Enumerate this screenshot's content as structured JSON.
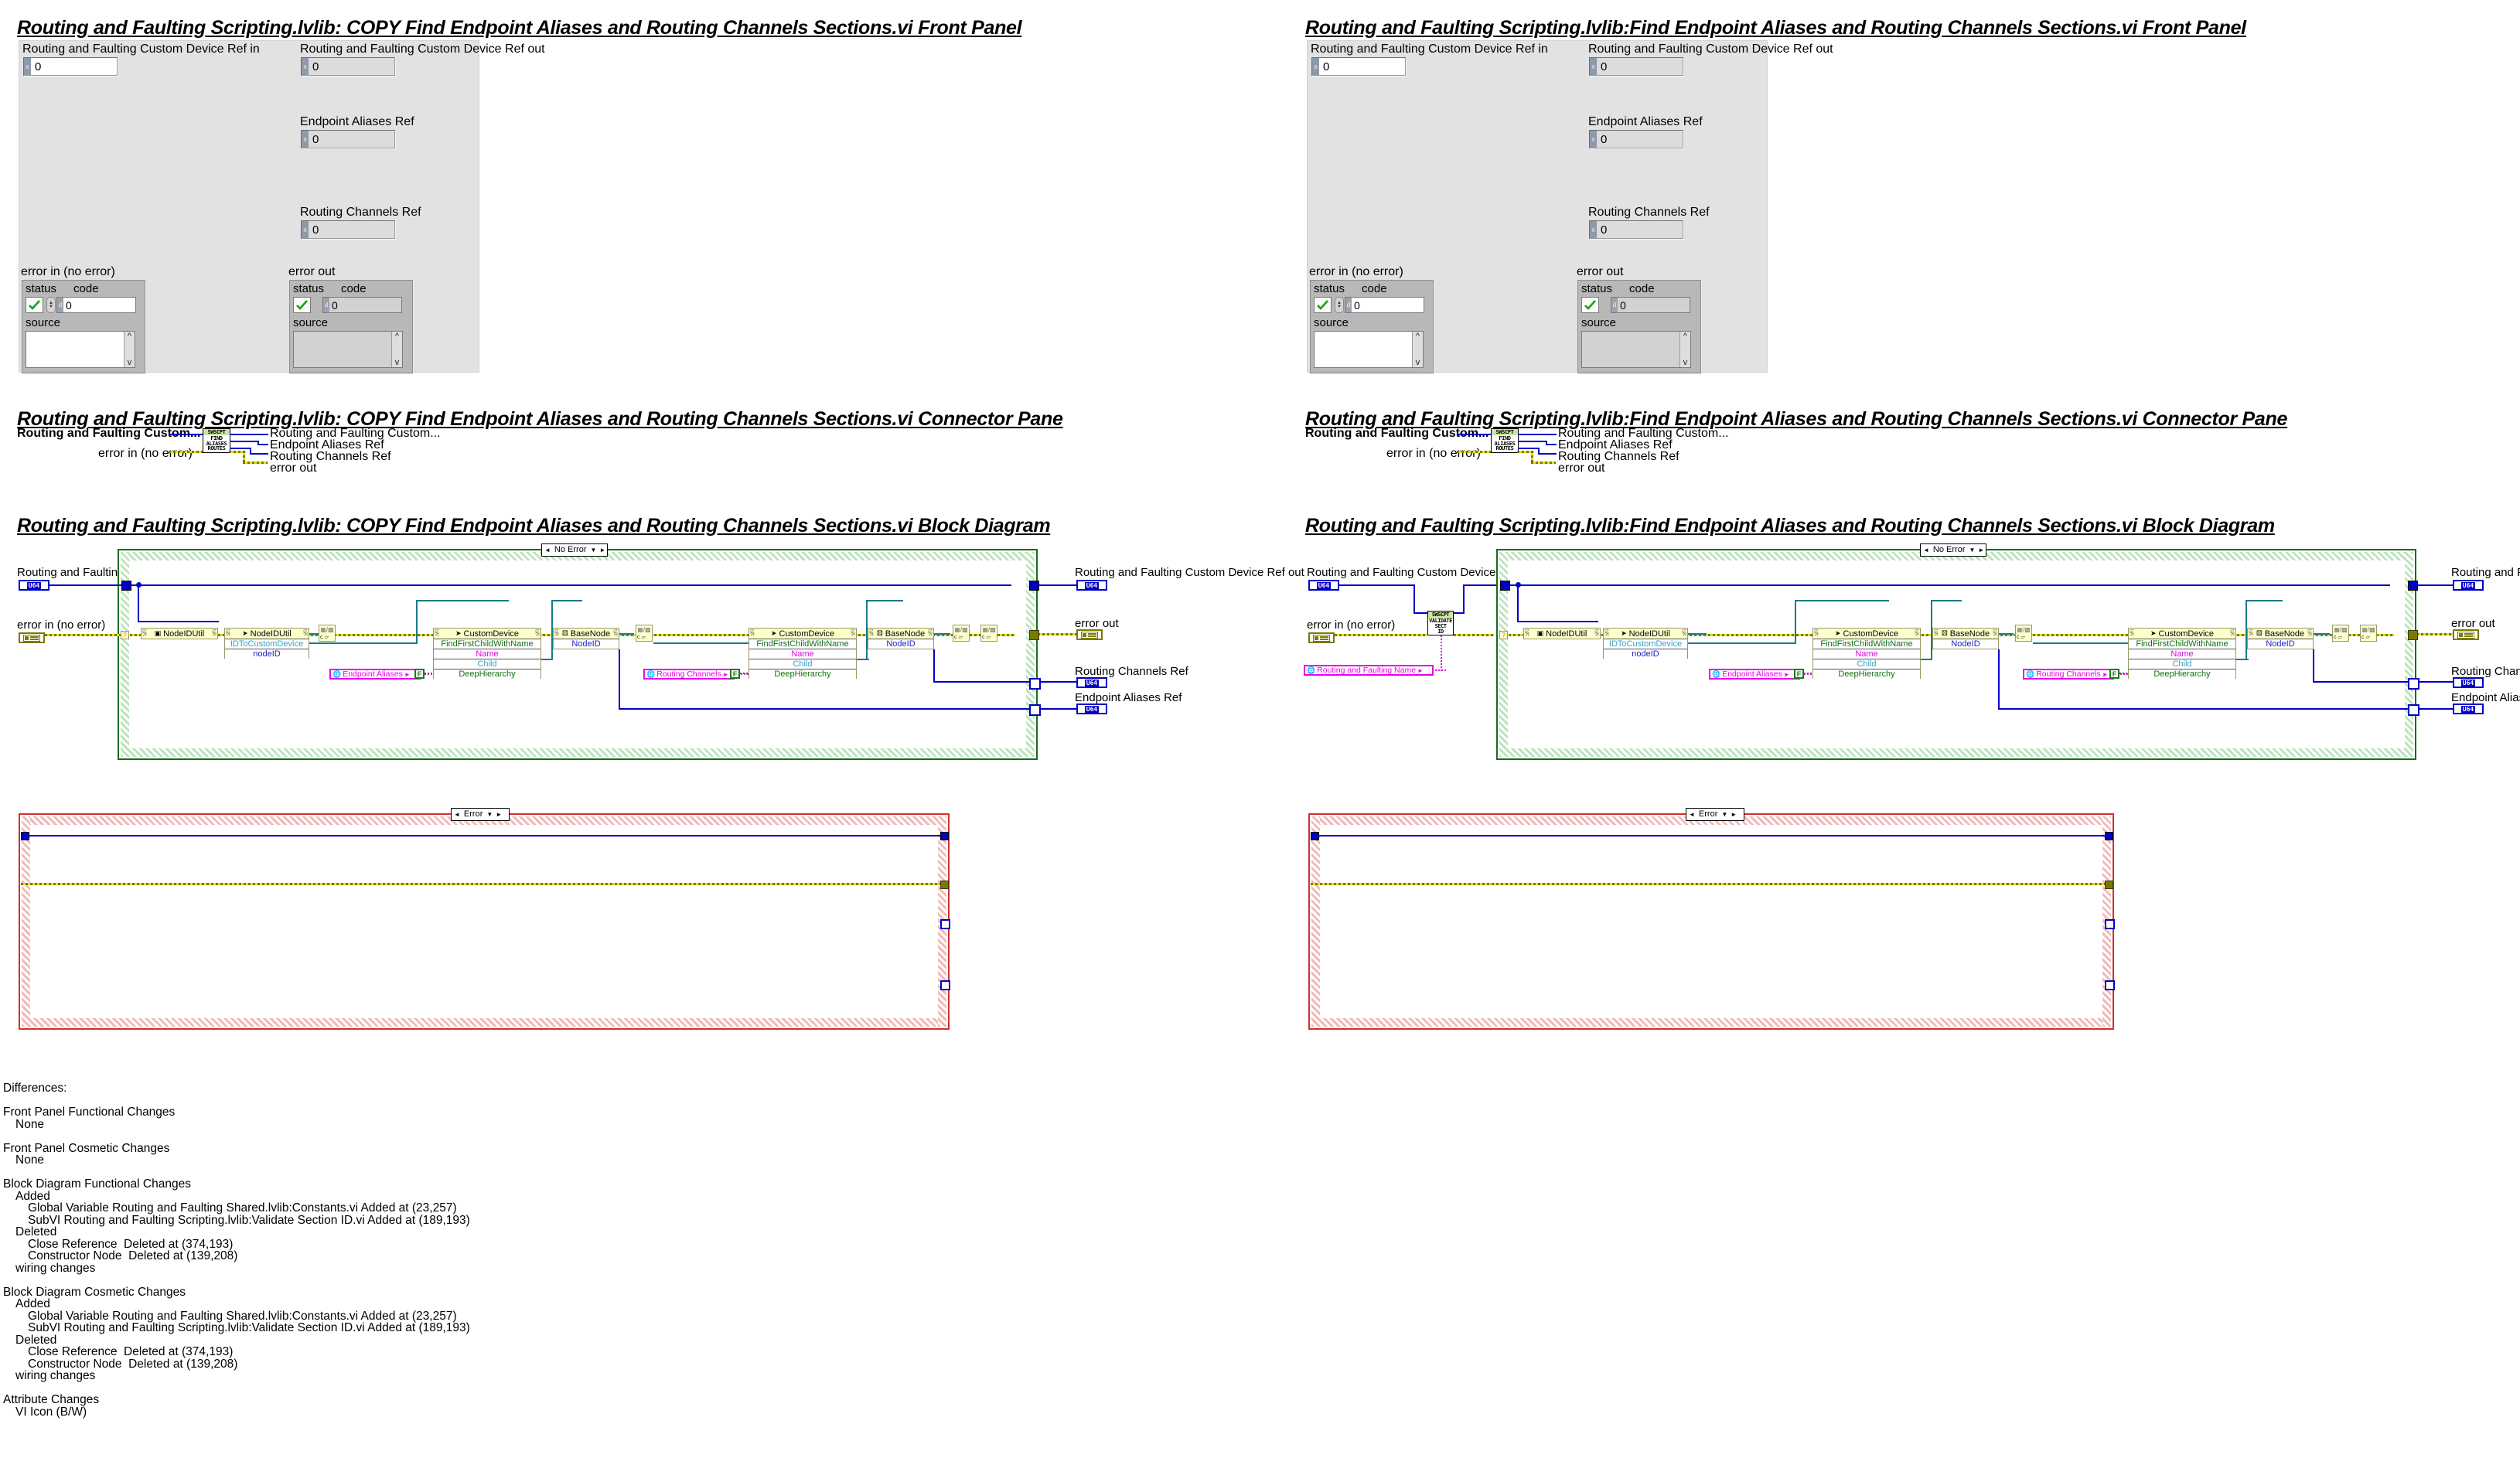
{
  "panels": [
    {
      "id": "left",
      "front_panel_title": "Routing and Faulting Scripting.lvlib:  COPY  Find Endpoint Aliases and Routing Channels Sections.vi Front Panel",
      "connector_pane_title": "Routing and Faulting Scripting.lvlib:  COPY  Find Endpoint Aliases and Routing Channels Sections.vi Connector Pane",
      "block_diagram_title": "Routing and Faulting Scripting.lvlib:  COPY  Find Endpoint Aliases and Routing Channels Sections.vi Block Diagram"
    },
    {
      "id": "right",
      "front_panel_title": "Routing and Faulting Scripting.lvlib:Find Endpoint Aliases and Routing Channels Sections.vi Front Panel",
      "connector_pane_title": "Routing and Faulting Scripting.lvlib:Find Endpoint Aliases and Routing Channels Sections.vi Connector Pane",
      "block_diagram_title": "Routing and Faulting Scripting.lvlib:Find Endpoint Aliases and Routing Channels Sections.vi Block Diagram"
    }
  ],
  "front_panel": {
    "ctrl_ref_in_label": "Routing and Faulting Custom Device Ref in",
    "ctrl_ref_out_label": "Routing and Faulting Custom Device Ref out",
    "endpoint_aliases_label": "Endpoint Aliases Ref",
    "routing_channels_label": "Routing Channels Ref",
    "ref_value": "0",
    "ref_stub": "x",
    "error_in_label": "error in (no error)",
    "error_out_label": "error out",
    "status_label": "status",
    "code_label": "code",
    "source_label": "source",
    "code_value": "0",
    "code_stub": "d",
    "source_value": "",
    "status_glyph": "check-mark",
    "scroll_up_glyph": "^",
    "scroll_down_glyph": "v"
  },
  "connector_pane": {
    "in_ref_label": "Routing and Faulting Custom...",
    "in_error_label": "error in (no error)",
    "out_ref_label": "Routing and Faulting Custom...",
    "out_endpoint_label": "Endpoint Aliases Ref",
    "out_routing_label": "Routing Channels Ref",
    "out_error_label": "error out",
    "icon_line1": "SWSCPT",
    "icon_line2": "FIND",
    "icon_line3": "ALIASES",
    "icon_line4": "ROUTES"
  },
  "block_diagram": {
    "terminal_ref_in_label": "Routing and Faulting Custom Device Ref in",
    "terminal_error_in_label": "error in (no error)",
    "terminal_ref_out_label": "Routing and Faulting Custom Device Ref out",
    "terminal_error_out_label": "error out",
    "terminal_routing_out_label": "Routing Channels Ref",
    "terminal_endpoint_out_label": "Endpoint Aliases Ref",
    "u64_glyph": "U64",
    "case_no_error": "No Error",
    "case_error": "Error",
    "case_left_arrow": "◄",
    "case_right_arrow": "►",
    "case_down_arrow": "▼",
    "nodes": {
      "nodeidutil_get": {
        "title": "NodeIDUtil",
        "glyph": "class-icon"
      },
      "nodeidutil_invoke": {
        "title": "NodeIDUtil",
        "method": "IDToCustomDevice",
        "param": "nodeID"
      },
      "customdevice_1": {
        "title": "CustomDevice",
        "method": "FindFirstChildWithName",
        "p1": "Name",
        "p2": "Child",
        "p3": "DeepHierarchy"
      },
      "customdevice_2": {
        "title": "CustomDevice",
        "method": "FindFirstChildWithName",
        "p1": "Name",
        "p2": "Child",
        "p3": "DeepHierarchy"
      },
      "basenode_1": {
        "title": "BaseNode",
        "prop": "NodeID"
      },
      "basenode_2": {
        "title": "BaseNode",
        "prop": "NodeID"
      }
    },
    "globals": {
      "endpoint_aliases": "Endpoint Aliases",
      "routing_channels": "Routing Channels",
      "routing_and_faulting_name": "Routing and Faulting Name"
    },
    "bool_false": "F",
    "close_ref_caption": "c",
    "validate_subvi": {
      "line1": "SWSCPT",
      "line2": "VALIDATE",
      "line3": "SECT",
      "line4": "ID"
    }
  },
  "differences": {
    "heading": "Differences:",
    "sections": [
      {
        "title": "Front Panel Functional Changes",
        "lines": [
          {
            "indent": 1,
            "text": "None"
          }
        ]
      },
      {
        "title": "Front Panel Cosmetic Changes",
        "lines": [
          {
            "indent": 1,
            "text": "None"
          }
        ]
      },
      {
        "title": "Block Diagram Functional Changes",
        "lines": [
          {
            "indent": 1,
            "text": "Added"
          },
          {
            "indent": 2,
            "text": "Global Variable Routing and Faulting Shared.lvlib:Constants.vi Added at (23,257)"
          },
          {
            "indent": 2,
            "text": "SubVI Routing and Faulting Scripting.lvlib:Validate Section ID.vi Added at (189,193)"
          },
          {
            "indent": 1,
            "text": "Deleted"
          },
          {
            "indent": 2,
            "text": "Close Reference  Deleted at (374,193)"
          },
          {
            "indent": 2,
            "text": "Constructor Node  Deleted at (139,208)"
          },
          {
            "indent": 1,
            "text": "wiring changes"
          }
        ]
      },
      {
        "title": "Block Diagram Cosmetic Changes",
        "lines": [
          {
            "indent": 1,
            "text": "Added"
          },
          {
            "indent": 2,
            "text": "Global Variable Routing and Faulting Shared.lvlib:Constants.vi Added at (23,257)"
          },
          {
            "indent": 2,
            "text": "SubVI Routing and Faulting Scripting.lvlib:Validate Section ID.vi Added at (189,193)"
          },
          {
            "indent": 1,
            "text": "Deleted"
          },
          {
            "indent": 2,
            "text": "Close Reference  Deleted at (374,193)"
          },
          {
            "indent": 2,
            "text": "Constructor Node  Deleted at (139,208)"
          },
          {
            "indent": 1,
            "text": "wiring changes"
          }
        ]
      },
      {
        "title": "Attribute Changes",
        "lines": [
          {
            "indent": 1,
            "text": "VI Icon (B/W)"
          }
        ]
      }
    ]
  },
  "colors": {
    "wire_refnum": "#0000c8",
    "wire_error": "#e8e800",
    "wire_teal": "#1a7a8a",
    "global_magenta": "#e800e8",
    "case_no_error": "#1a6b1a",
    "case_error": "#d03030",
    "node_bg": "#ffffcc"
  }
}
